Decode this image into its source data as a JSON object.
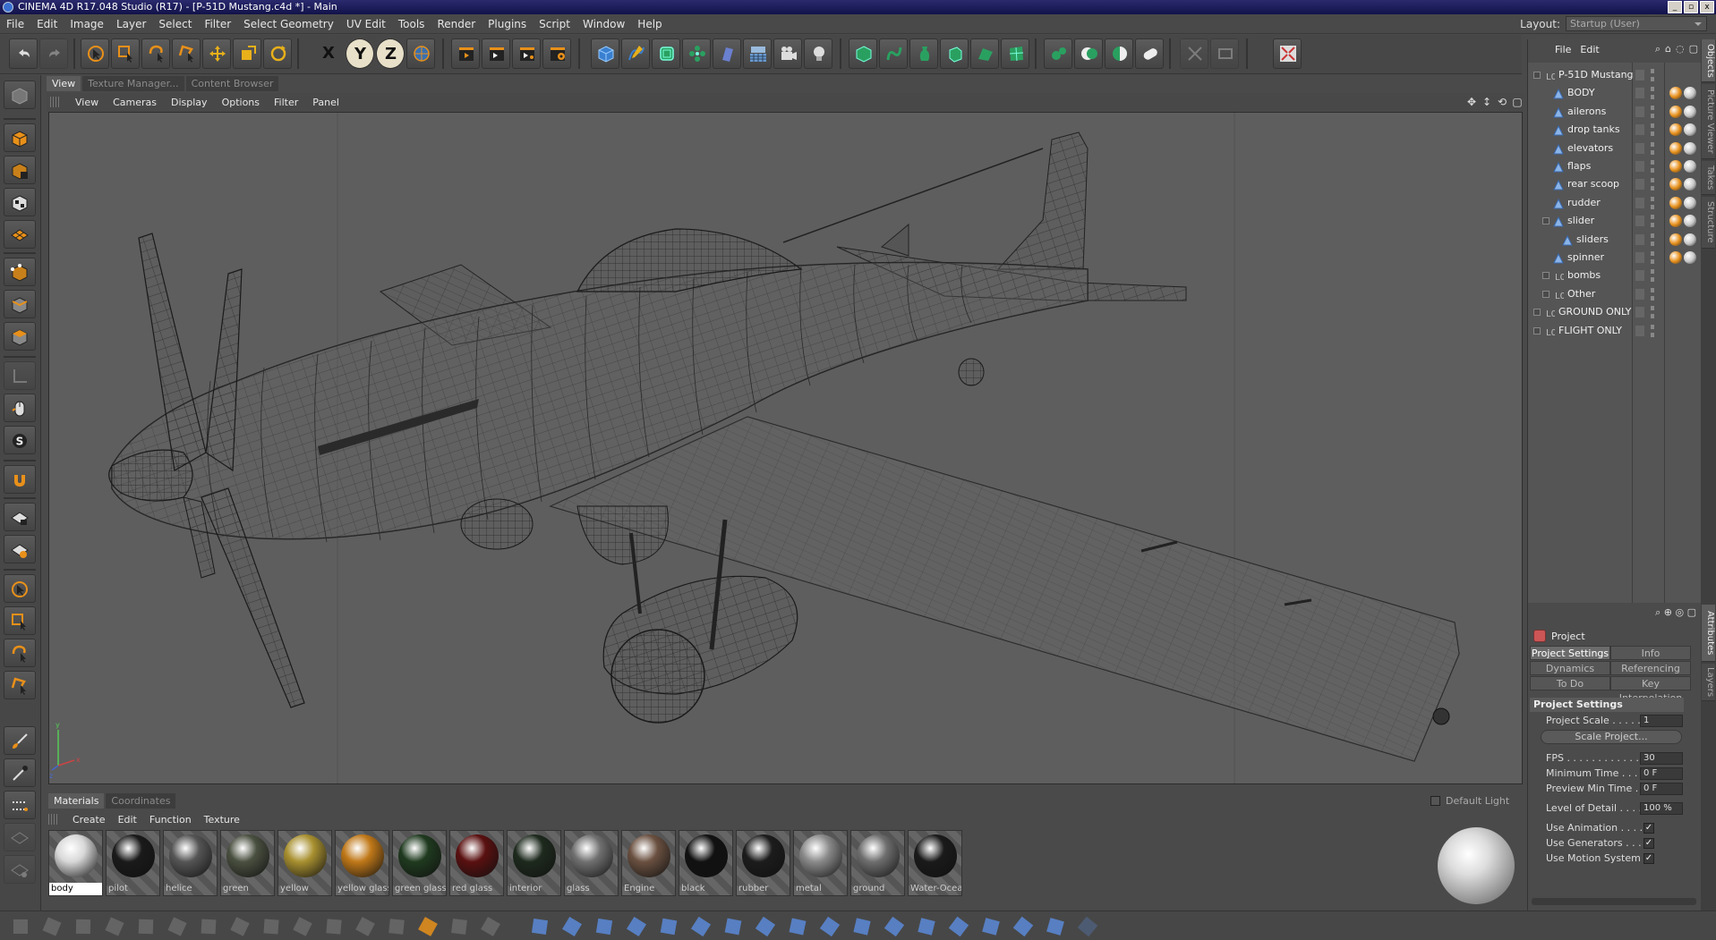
{
  "window": {
    "title": "CINEMA 4D R17.048 Studio (R17) - [P-51D Mustang.c4d *] - Main",
    "buttons": [
      "_",
      "▫",
      "x"
    ]
  },
  "menu": [
    "File",
    "Edit",
    "Image",
    "Layer",
    "Select",
    "Filter",
    "Select Geometry",
    "UV Edit",
    "Tools",
    "Render",
    "Plugins",
    "Script",
    "Window",
    "Help"
  ],
  "layout": {
    "label": "Layout:",
    "value": "Startup (User)"
  },
  "toolbar": {
    "x": "X",
    "y": "Y",
    "z": "Z"
  },
  "viewport": {
    "tabs": [
      "View",
      "Texture Manager...",
      "Content Browser"
    ],
    "menu": [
      "View",
      "Cameras",
      "Display",
      "Options",
      "Filter",
      "Panel"
    ]
  },
  "materials": {
    "tabs": [
      "Materials",
      "Coordinates"
    ],
    "menu": [
      "Create",
      "Edit",
      "Function",
      "Texture"
    ],
    "items": [
      {
        "name": "body",
        "color": "#d8d8d8"
      },
      {
        "name": "pilot",
        "color": "#1a1a1a"
      },
      {
        "name": "helice",
        "color": "#555555"
      },
      {
        "name": "green",
        "color": "#4a5040"
      },
      {
        "name": "yellow",
        "color": "#a89030"
      },
      {
        "name": "yellow glass",
        "color": "#c07818"
      },
      {
        "name": "green glass",
        "color": "#1f3a1f"
      },
      {
        "name": "red glass",
        "color": "#5a1010"
      },
      {
        "name": "interior",
        "color": "#1e2a1e"
      },
      {
        "name": "glass",
        "color": "#707070"
      },
      {
        "name": "Engine",
        "color": "#6a5040"
      },
      {
        "name": "black",
        "color": "#111111"
      },
      {
        "name": "rubber",
        "color": "#1c1c1c"
      },
      {
        "name": "metal",
        "color": "#8a8a8a"
      },
      {
        "name": "ground",
        "color": "#6e6e6e"
      },
      {
        "name": "Water-Ocea",
        "color": "#1a1a1a"
      }
    ],
    "default_light": "Default Light"
  },
  "objects": {
    "menu": [
      "File",
      "Edit"
    ],
    "tree": [
      {
        "name": "P-51D Mustang",
        "level": 0,
        "type": "null",
        "expand": "-"
      },
      {
        "name": "BODY",
        "level": 1,
        "type": "poly"
      },
      {
        "name": "ailerons",
        "level": 1,
        "type": "poly"
      },
      {
        "name": "drop tanks",
        "level": 1,
        "type": "poly"
      },
      {
        "name": "elevators",
        "level": 1,
        "type": "poly"
      },
      {
        "name": "flaps",
        "level": 1,
        "type": "poly"
      },
      {
        "name": "rear scoop",
        "level": 1,
        "type": "poly"
      },
      {
        "name": "rudder",
        "level": 1,
        "type": "poly"
      },
      {
        "name": "slider",
        "level": 1,
        "type": "poly",
        "expand": "-"
      },
      {
        "name": "sliders",
        "level": 2,
        "type": "poly"
      },
      {
        "name": "spinner",
        "level": 1,
        "type": "poly"
      },
      {
        "name": "bombs",
        "level": 1,
        "type": "null",
        "expand": "+"
      },
      {
        "name": "Other",
        "level": 1,
        "type": "null",
        "expand": "+"
      },
      {
        "name": "GROUND ONLY",
        "level": 0,
        "type": "null",
        "expand": "+"
      },
      {
        "name": "FLIGHT ONLY",
        "level": 0,
        "type": "null",
        "expand": "+"
      }
    ]
  },
  "attributes": {
    "title": "Project",
    "tabs": [
      "Project Settings",
      "Info",
      "Dynamics",
      "Referencing",
      "To Do",
      "Key Interpolation"
    ],
    "section": "Project Settings",
    "rows": [
      {
        "label": "Project Scale . . . . . .",
        "value": "1"
      },
      {
        "label": "FPS . . . . . . . . . . . . . .",
        "value": "30"
      },
      {
        "label": "Minimum Time . . . . .",
        "value": "0 F"
      },
      {
        "label": "Preview Min Time . .",
        "value": "0 F"
      },
      {
        "label": "Level of Detail . . . .",
        "value": "100 %"
      }
    ],
    "scale_button": "Scale Project...",
    "checks": [
      {
        "label": "Use Animation . . . . .",
        "checked": "✓"
      },
      {
        "label": "Use Generators . . . .",
        "checked": "✓"
      },
      {
        "label": "Use Motion System",
        "checked": "✓"
      }
    ]
  },
  "side_tabs": [
    "Objects",
    "Picture Viewer",
    "Takes",
    "Structure",
    "Attributes",
    "Layers"
  ],
  "colors": {
    "accent": "#e8901a",
    "selection": "#d4a020",
    "background": "#4a4a4a",
    "viewport": "#5e5e5e"
  }
}
